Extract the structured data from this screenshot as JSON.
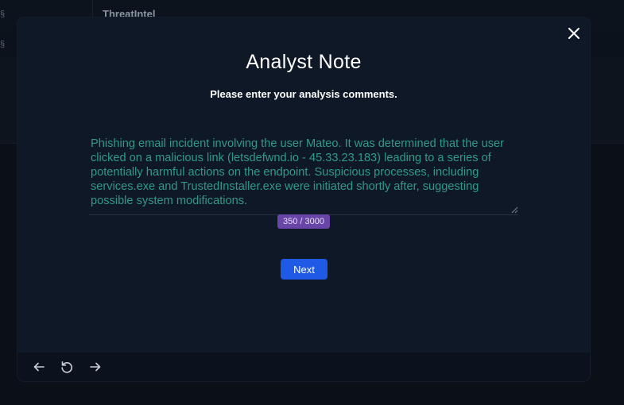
{
  "background": {
    "tab_title": "ThreatIntel",
    "left_fragment_1": "§",
    "left_fragment_2": "§"
  },
  "modal": {
    "title": "Analyst Note",
    "subtitle": "Please enter your analysis comments.",
    "note_text": "Phishing email incident involving the user Mateo. It was determined that the user clicked on a malicious link (letsdefwnd.io - 45.33.23.183) leading to a series of potentially harmful actions on the endpoint. Suspicious processes, including services.exe and TrustedInstaller.exe were initiated shortly after, suggesting possible system modifications.",
    "char_count": "350 / 3000",
    "next_label": "Next",
    "close_icon": "close-icon"
  },
  "footer": {
    "back_icon": "arrow-left-icon",
    "reset_icon": "refresh-icon",
    "forward_icon": "arrow-right-icon"
  },
  "colors": {
    "accent_button": "#1f5ae6",
    "counter_badge": "#6a45a8",
    "note_text": "#2f9a8a",
    "modal_bg": "#0f1826"
  }
}
